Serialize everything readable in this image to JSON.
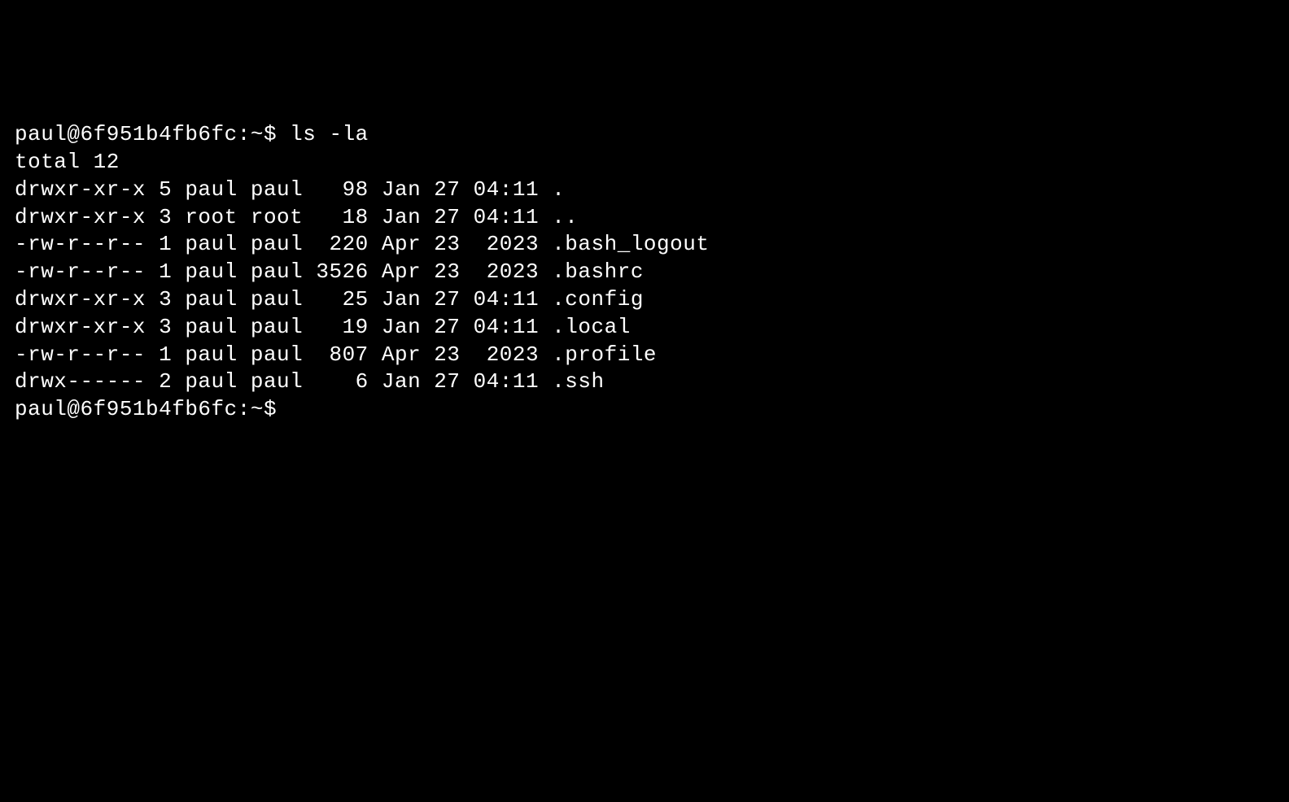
{
  "terminal": {
    "prompt1": "paul@6f951b4fb6fc:~$ ",
    "command1": "ls -la",
    "total_line": "total 12",
    "entries": [
      {
        "perms": "drwxr-xr-x",
        "links": "5",
        "owner": "paul",
        "group": "paul",
        "size": "98",
        "month": "Jan",
        "day": "27",
        "timeyear": "04:11",
        "name": "."
      },
      {
        "perms": "drwxr-xr-x",
        "links": "3",
        "owner": "root",
        "group": "root",
        "size": "18",
        "month": "Jan",
        "day": "27",
        "timeyear": "04:11",
        "name": ".."
      },
      {
        "perms": "-rw-r--r--",
        "links": "1",
        "owner": "paul",
        "group": "paul",
        "size": "220",
        "month": "Apr",
        "day": "23",
        "timeyear": " 2023",
        "name": ".bash_logout"
      },
      {
        "perms": "-rw-r--r--",
        "links": "1",
        "owner": "paul",
        "group": "paul",
        "size": "3526",
        "month": "Apr",
        "day": "23",
        "timeyear": " 2023",
        "name": ".bashrc"
      },
      {
        "perms": "drwxr-xr-x",
        "links": "3",
        "owner": "paul",
        "group": "paul",
        "size": "25",
        "month": "Jan",
        "day": "27",
        "timeyear": "04:11",
        "name": ".config"
      },
      {
        "perms": "drwxr-xr-x",
        "links": "3",
        "owner": "paul",
        "group": "paul",
        "size": "19",
        "month": "Jan",
        "day": "27",
        "timeyear": "04:11",
        "name": ".local"
      },
      {
        "perms": "-rw-r--r--",
        "links": "1",
        "owner": "paul",
        "group": "paul",
        "size": "807",
        "month": "Apr",
        "day": "23",
        "timeyear": " 2023",
        "name": ".profile"
      },
      {
        "perms": "drwx------",
        "links": "2",
        "owner": "paul",
        "group": "paul",
        "size": "6",
        "month": "Jan",
        "day": "27",
        "timeyear": "04:11",
        "name": ".ssh"
      }
    ],
    "prompt2": "paul@6f951b4fb6fc:~$ "
  }
}
